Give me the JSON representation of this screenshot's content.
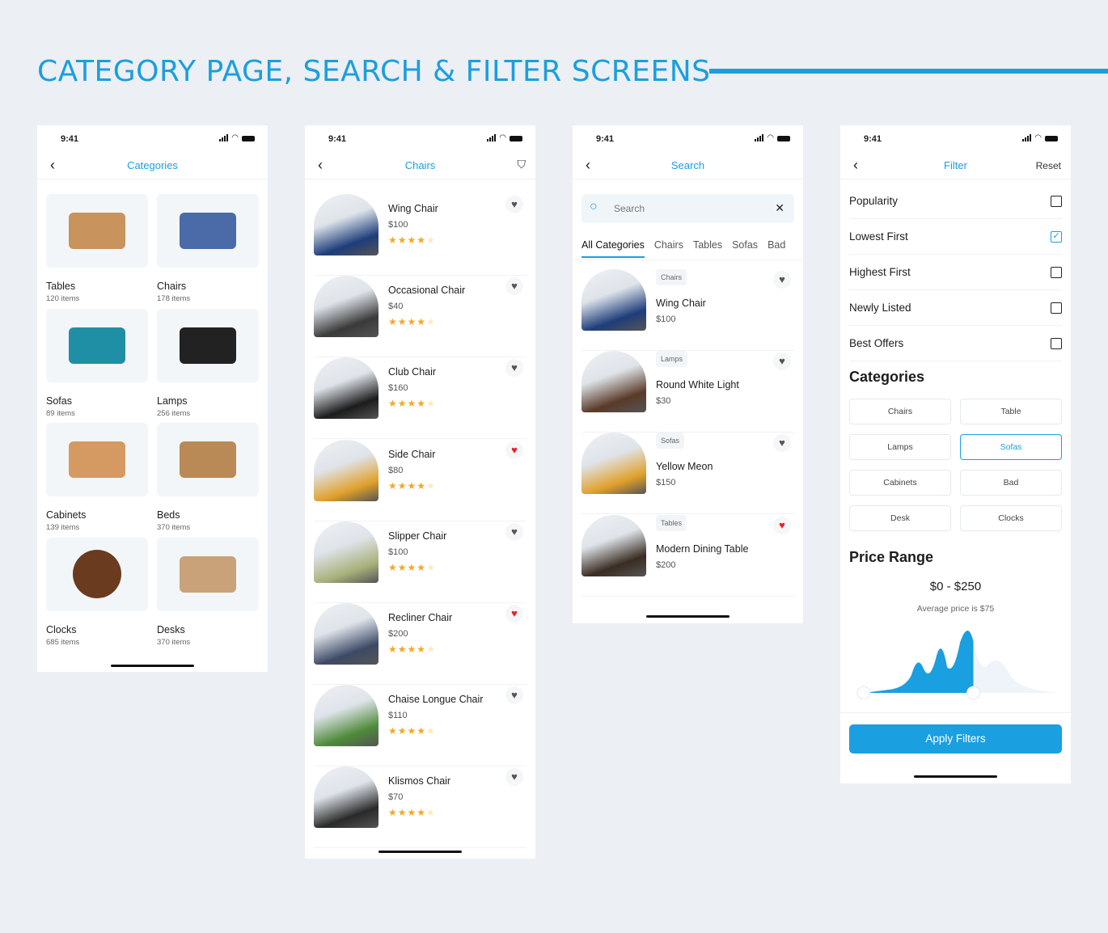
{
  "page_title": "CATEGORY PAGE, SEARCH & FILTER SCREENS",
  "colors": {
    "accent": "#1a9fe0",
    "star": "#f5a623",
    "heart_active": "#e8202a",
    "background": "#eceff3"
  },
  "status_time": "9:41",
  "categories_screen": {
    "title": "Categories",
    "items": [
      {
        "name": "Tables",
        "count": "120 items",
        "color": "#c8935c"
      },
      {
        "name": "Chairs",
        "count": "178 items",
        "color": "#4a6aa8"
      },
      {
        "name": "Sofas",
        "count": "89 items",
        "color": "#1f8fa5"
      },
      {
        "name": "Lamps",
        "count": "256 items",
        "color": "#222222"
      },
      {
        "name": "Cabinets",
        "count": "139 items",
        "color": "#d49a62"
      },
      {
        "name": "Beds",
        "count": "370 items",
        "color": "#b98a55"
      },
      {
        "name": "Clocks",
        "count": "685 items",
        "color": "#6b3b1f"
      },
      {
        "name": "Desks",
        "count": "370 items",
        "color": "#c9a27a"
      }
    ]
  },
  "chairs_screen": {
    "title": "Chairs",
    "filter_icon": "filter-search-icon",
    "items": [
      {
        "name": "Wing Chair",
        "price": "$100",
        "rating": 4,
        "liked": false,
        "color": "#1e3d7a"
      },
      {
        "name": "Occasional Chair",
        "price": "$40",
        "rating": 4,
        "liked": false,
        "color": "#3a3a3a"
      },
      {
        "name": "Club Chair",
        "price": "$160",
        "rating": 4,
        "liked": false,
        "color": "#1c1c1c"
      },
      {
        "name": "Side Chair",
        "price": "$80",
        "rating": 4,
        "liked": true,
        "color": "#e0a02a"
      },
      {
        "name": "Slipper Chair",
        "price": "$100",
        "rating": 4,
        "liked": false,
        "color": "#a8b07a"
      },
      {
        "name": "Recliner Chair",
        "price": "$200",
        "rating": 4,
        "liked": true,
        "color": "#3c4a66"
      },
      {
        "name": "Chaise Longue Chair",
        "price": "$110",
        "rating": 4,
        "liked": false,
        "color": "#4f8a3a"
      },
      {
        "name": "Klismos Chair",
        "price": "$70",
        "rating": 4,
        "liked": false,
        "color": "#2a2a2a"
      }
    ]
  },
  "search_screen": {
    "title": "Search",
    "placeholder": "Search",
    "tabs": [
      "All Categories",
      "Chairs",
      "Tables",
      "Sofas",
      "Bad"
    ],
    "active_tab": 0,
    "items": [
      {
        "tag": "Chairs",
        "name": "Wing Chair",
        "price": "$100",
        "liked": false,
        "color": "#1e3d7a"
      },
      {
        "tag": "Lamps",
        "name": "Round White Light",
        "price": "$30",
        "liked": false,
        "color": "#5a3a28"
      },
      {
        "tag": "Sofas",
        "name": "Yellow Meon",
        "price": "$150",
        "liked": false,
        "color": "#e0a02a"
      },
      {
        "tag": "Tables",
        "name": "Modern Dining Table",
        "price": "$200",
        "liked": true,
        "color": "#3a2c22"
      }
    ]
  },
  "filter_screen": {
    "title": "Filter",
    "reset": "Reset",
    "sort_options": [
      {
        "label": "Popularity",
        "checked": false
      },
      {
        "label": "Lowest First",
        "checked": true
      },
      {
        "label": "Highest First",
        "checked": false
      },
      {
        "label": "Newly Listed",
        "checked": false
      },
      {
        "label": "Best Offers",
        "checked": false
      }
    ],
    "categories_heading": "Categories",
    "categories": [
      {
        "label": "Chairs",
        "selected": false
      },
      {
        "label": "Table",
        "selected": false
      },
      {
        "label": "Lamps",
        "selected": false
      },
      {
        "label": "Sofas",
        "selected": true
      },
      {
        "label": "Cabinets",
        "selected": false
      },
      {
        "label": "Bad",
        "selected": false
      },
      {
        "label": "Desk",
        "selected": false
      },
      {
        "label": "Clocks",
        "selected": false
      }
    ],
    "price_heading": "Price Range",
    "price_range": "$0 - $250",
    "average": "Average price is $75",
    "slider_low_fraction": 0,
    "slider_high_fraction": 0.55,
    "apply": "Apply Filters"
  }
}
